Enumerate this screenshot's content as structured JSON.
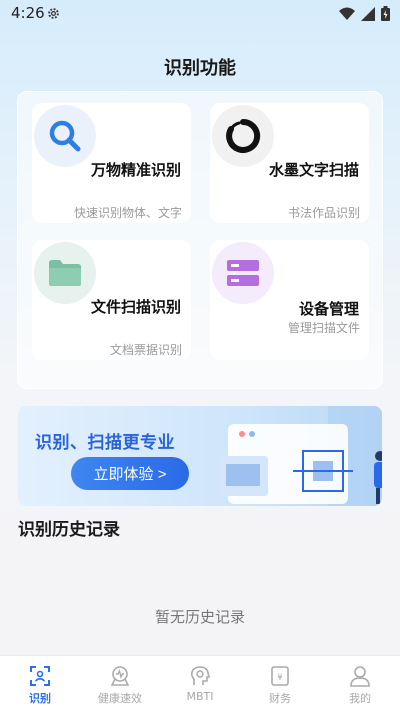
{
  "status_bar": {
    "time": "4:26"
  },
  "page_title": "识别功能",
  "cards": [
    {
      "title": "万物精准识别",
      "subtitle": "快速识别物体、文字",
      "icon": "search-icon"
    },
    {
      "title": "水墨文字扫描",
      "subtitle": "书法作品识别",
      "icon": "ink-circle-icon"
    },
    {
      "title": "文件扫描识别",
      "subtitle": "文档票据识别",
      "icon": "folder-icon"
    },
    {
      "title": "设备管理",
      "subtitle": "管理扫描文件",
      "icon": "server-icon"
    }
  ],
  "banner": {
    "title": "识别、扫描更专业",
    "button": "立即体验 >"
  },
  "history": {
    "title": "识别历史记录",
    "empty": "暂无历史记录"
  },
  "nav": [
    {
      "label": "识别",
      "icon": "scan-icon"
    },
    {
      "label": "健康速效",
      "icon": "health-icon"
    },
    {
      "label": "MBTI",
      "icon": "mbti-icon"
    },
    {
      "label": "财务",
      "icon": "finance-icon"
    },
    {
      "label": "我的",
      "icon": "user-icon"
    }
  ],
  "colors": {
    "accent": "#2f6fe8",
    "banner_text": "#2a63d9"
  }
}
